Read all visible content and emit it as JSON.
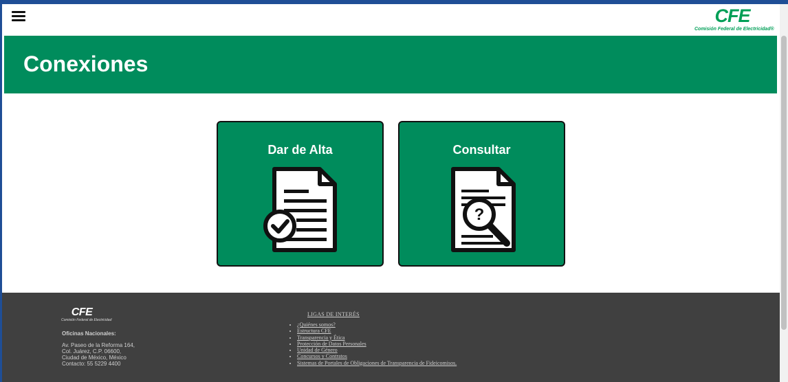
{
  "header": {
    "menu_icon": "hamburger-menu-icon",
    "logo_mark": "CFE",
    "logo_subtitle": "Comisión Federal de Electricidad®"
  },
  "banner": {
    "title": "Conexiones"
  },
  "cards": [
    {
      "label": "Dar de Alta",
      "icon": "document-checkmark-icon"
    },
    {
      "label": "Consultar",
      "icon": "document-search-icon"
    }
  ],
  "footer": {
    "logo_mark": "CFE",
    "logo_subtitle": "Comisión Federal de Electricidad",
    "office_title": "Oficinas Nacionales:",
    "address": [
      "Av. Paseo de la Reforma 164,",
      "Col. Juárez, C.P. 06600,",
      "Ciudad de México, México",
      "Contacto: 55 5229 4400"
    ],
    "links_title": "LIGAS DE INTERÉS",
    "links": [
      "¿Quiénes somos?",
      "Estructura CFE",
      "Transparencia y Ética",
      "Protección de Datos Personales",
      "Unidad de Género",
      "Concursos y Contratos",
      "Sistemas de Portales de Obligaciones de Transparencia de Fideicomisos."
    ]
  },
  "colors": {
    "brand_green": "#008c5c",
    "logo_green": "#009f57",
    "footer_bg": "#404040"
  }
}
